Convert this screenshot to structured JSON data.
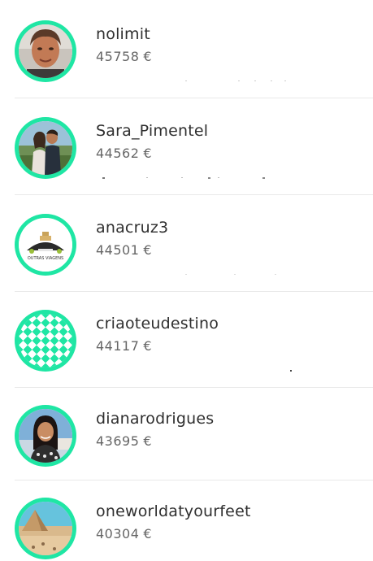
{
  "currency": "€",
  "users": [
    {
      "name": "nolimit",
      "amount": "45758",
      "avatar": "portrait-man-icon"
    },
    {
      "name": "Sara_Pimentel",
      "amount": "44562",
      "avatar": "couple-photo-icon"
    },
    {
      "name": "anacruz3",
      "amount": "44501",
      "avatar": "travel-logo-icon"
    },
    {
      "name": "criaoteudestino",
      "amount": "44117",
      "avatar": "diamond-pattern-icon"
    },
    {
      "name": "dianarodrigues",
      "amount": "43695",
      "avatar": "portrait-woman-icon"
    },
    {
      "name": "oneworldatyourfeet",
      "amount": "40304",
      "avatar": "pyramid-photo-icon"
    }
  ],
  "colors": {
    "avatar_ring": "#1fe6a4",
    "name_text": "#2f2f2f",
    "amount_text": "#666666",
    "divider": "#e9e9e9"
  }
}
